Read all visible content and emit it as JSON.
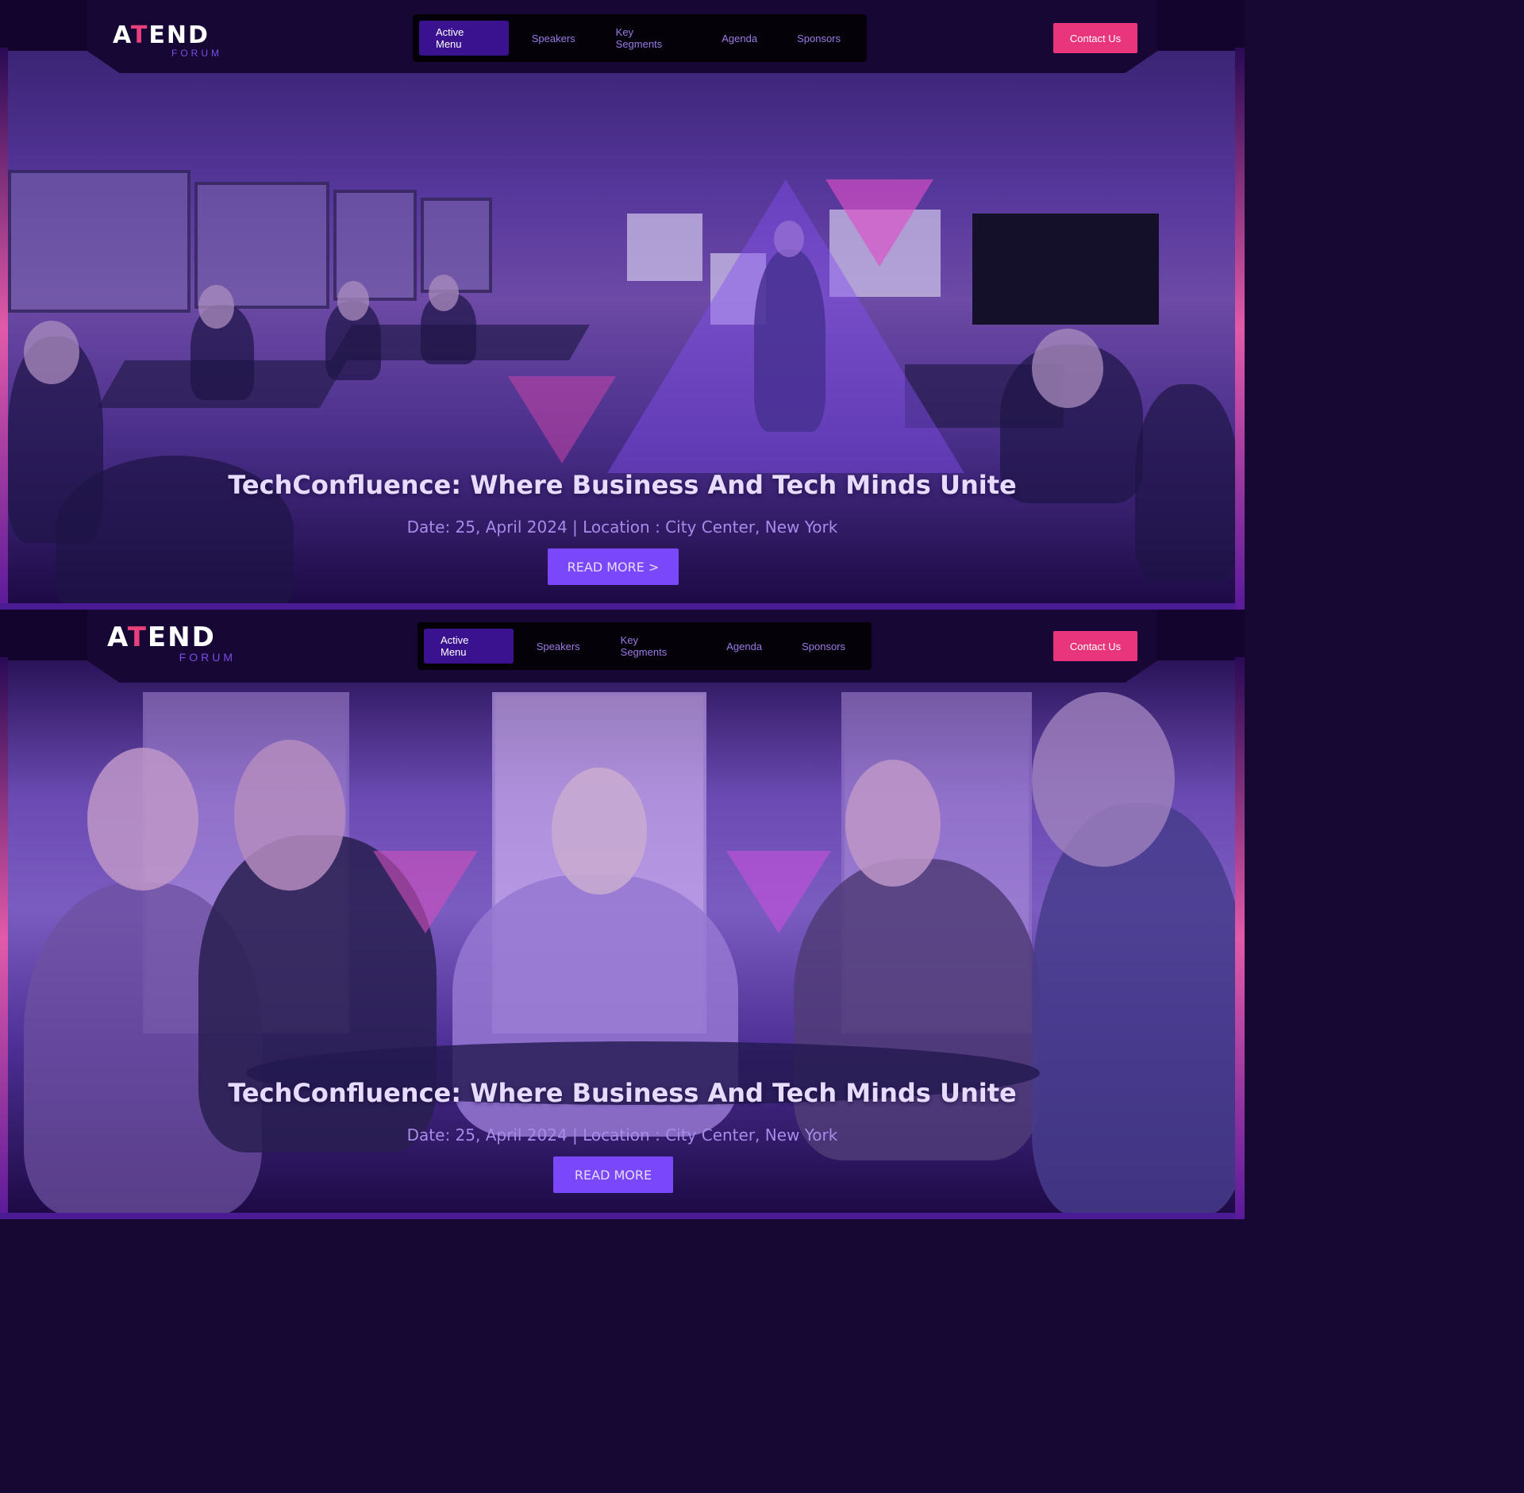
{
  "brand": {
    "logo_text_a": "A",
    "logo_text_t": "T",
    "logo_text_rest": "END",
    "logo_sub": "FORUM",
    "colors": {
      "accent": "#e8357c",
      "primary": "#7a48fa",
      "nav_active": "#3a1290",
      "nav_text": "#9b7ae6",
      "background": "#12042d"
    }
  },
  "frames": [
    {
      "nav": {
        "items": [
          "Active Menu",
          "Speakers",
          "Key Segments",
          "Agenda",
          "Sponsors"
        ],
        "active": "Active Menu"
      },
      "contact_label": "Contact Us",
      "hero": {
        "title": "TechConfluence: Where Business And Tech Minds Unite",
        "meta": "Date: 25, April 2024 | Location : City Center, New York",
        "button_label": "READ MORE >"
      }
    },
    {
      "nav": {
        "items": [
          "Active Menu",
          "Speakers",
          "Key Segments",
          "Agenda",
          "Sponsors"
        ],
        "active": "Active Menu"
      },
      "contact_label": "Contact Us",
      "hero": {
        "title": "TechConfluence: Where Business And Tech Minds Unite",
        "meta": "Date: 25, April 2024 | Location : City Center, New York",
        "button_label": "READ MORE"
      }
    }
  ]
}
